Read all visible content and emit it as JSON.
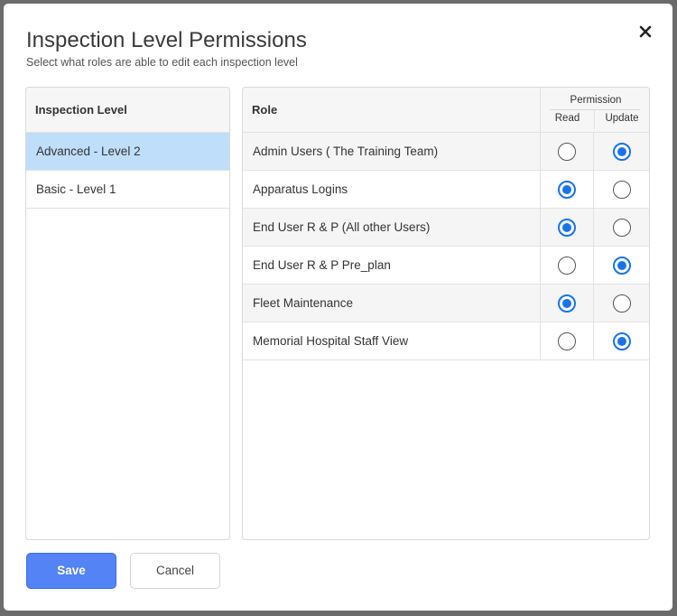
{
  "dialog": {
    "title": "Inspection Level Permissions",
    "subtitle": "Select what roles are able to edit each inspection level",
    "close_icon": "close-icon"
  },
  "levels": {
    "header": "Inspection Level",
    "items": [
      {
        "label": "Advanced - Level 2",
        "selected": true
      },
      {
        "label": "Basic - Level 1",
        "selected": false
      }
    ]
  },
  "roles": {
    "header": "Role",
    "permission_header": "Permission",
    "read_header": "Read",
    "update_header": "Update",
    "rows": [
      {
        "role": "Admin Users ( The Training Team)",
        "permission": "update"
      },
      {
        "role": "Apparatus Logins",
        "permission": "read"
      },
      {
        "role": "End User R & P (All other Users)",
        "permission": "read"
      },
      {
        "role": "End User R & P Pre_plan",
        "permission": "update"
      },
      {
        "role": "Fleet Maintenance",
        "permission": "read"
      },
      {
        "role": "Memorial Hospital Staff View",
        "permission": "update"
      }
    ]
  },
  "actions": {
    "save_label": "Save",
    "cancel_label": "Cancel"
  },
  "colors": {
    "accent": "#1a73e8",
    "save_button": "#5383f4",
    "selected_row": "#bfdefa"
  }
}
